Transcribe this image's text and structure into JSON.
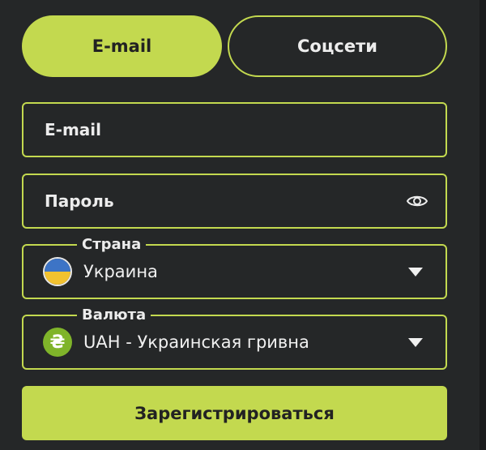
{
  "tabs": {
    "email_label": "E-mail",
    "social_label": "Соцсети"
  },
  "form": {
    "email_placeholder": "E-mail",
    "password_placeholder": "Пароль",
    "country": {
      "legend": "Страна",
      "value": "Украина"
    },
    "currency": {
      "legend": "Валюта",
      "value": "UAH - Украинская гривна",
      "symbol": "₴"
    },
    "submit_label": "Зарегистрироваться"
  },
  "colors": {
    "accent": "#c3d94f",
    "background": "#252728"
  }
}
